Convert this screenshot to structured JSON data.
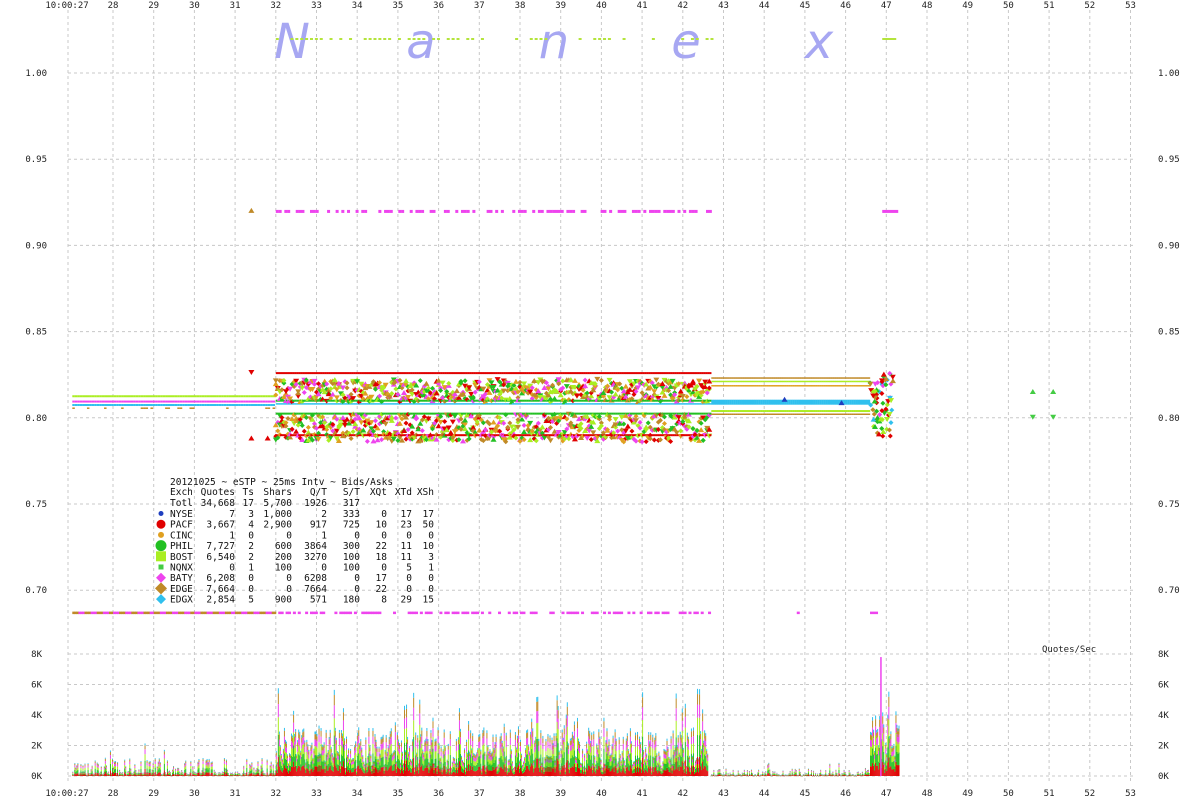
{
  "watermark": [
    "N",
    "a",
    "n",
    "e",
    "x"
  ],
  "chart_data": [
    {
      "type": "scatter",
      "subtype": "tick-chart",
      "title": "20121025 ~ eSTP ~ 25ms Intv ~ Bids/Asks",
      "x_start_label": "10:00:27",
      "x_labels": [
        "28",
        "29",
        "30",
        "31",
        "32",
        "33",
        "34",
        "35",
        "36",
        "37",
        "38",
        "39",
        "40",
        "41",
        "42",
        "43",
        "44",
        "45",
        "46",
        "47",
        "48",
        "49",
        "50",
        "51",
        "52",
        "53"
      ],
      "y_ticks": [
        "1.00",
        "0.95",
        "0.90",
        "0.85",
        "0.80",
        "0.75",
        "0.70"
      ],
      "ylim": [
        0.675,
        1.04
      ],
      "grid": true,
      "colors": {
        "NYSE": "#1f3fbf",
        "PACF": "#e00000",
        "CINC": "#e0a020",
        "PHIL": "#22c022",
        "BOST": "#aaee22",
        "NQNX": "#44cc44",
        "BATY": "#ee44ee",
        "EDGE": "#c08a28",
        "EDGX": "#30c0ee"
      },
      "series": [
        {
          "name": "EDGX",
          "segments": [
            {
              "x0": 27.0,
              "x1": 31.9,
              "bid": 0.808,
              "ask": 0.808
            },
            {
              "x0": 42.7,
              "x1": 46.5,
              "bid": 0.806,
              "ask": 0.81
            }
          ]
        },
        {
          "name": "BOST",
          "segments": [
            {
              "x0": 27.0,
              "x1": 31.9,
              "bid": 0.811,
              "ask": 0.811
            },
            {
              "x0": 42.7,
              "x1": 46.5,
              "bid": 0.819,
              "ask": 0.823
            }
          ]
        },
        {
          "name": "PACF",
          "segments": [
            {
              "x0": 32.0,
              "x1": 42.6,
              "bid": 0.789,
              "ask": 0.827
            }
          ]
        },
        {
          "name": "BATY",
          "segments": [
            {
              "x0": 31.9,
              "x1": 42.7,
              "bid": 0.687,
              "ask": 0.92
            }
          ]
        }
      ],
      "legend": {
        "headers": [
          "Exch",
          "Quotes",
          "Ts",
          "Shars",
          "Q/T",
          "S/T",
          "XQt",
          "XTd",
          "XSh"
        ],
        "total": [
          "Totl",
          "34,668",
          "17",
          "5,700",
          "1926",
          "317",
          "",
          "",
          ""
        ],
        "rows": [
          [
            "NYSE",
            "7",
            "3",
            "1,000",
            "2",
            "333",
            "0",
            "17",
            "17"
          ],
          [
            "PACF",
            "3,667",
            "4",
            "2,900",
            "917",
            "725",
            "10",
            "23",
            "50"
          ],
          [
            "CINC",
            "1",
            "0",
            "0",
            "1",
            "0",
            "0",
            "0",
            "0"
          ],
          [
            "PHIL",
            "7,727",
            "2",
            "600",
            "3864",
            "300",
            "22",
            "11",
            "10"
          ],
          [
            "BOST",
            "6,540",
            "2",
            "200",
            "3270",
            "100",
            "18",
            "11",
            "3"
          ],
          [
            "NQNX",
            "0",
            "1",
            "100",
            "0",
            "100",
            "0",
            "5",
            "1"
          ],
          [
            "BATY",
            "6,208",
            "0",
            "0",
            "6208",
            "0",
            "17",
            "0",
            "0"
          ],
          [
            "EDGE",
            "7,664",
            "0",
            "0",
            "7664",
            "0",
            "22",
            "0",
            "0"
          ],
          [
            "EDGX",
            "2,854",
            "5",
            "900",
            "571",
            "180",
            "8",
            "29",
            "15"
          ]
        ]
      }
    },
    {
      "type": "bar",
      "title": "Quotes/Sec",
      "y_ticks": [
        "8K",
        "6K",
        "4K",
        "2K",
        "0K"
      ],
      "ylim": [
        0,
        8000
      ],
      "grid": true,
      "bursts": [
        {
          "x0": 27.0,
          "x1": 32.0,
          "level": 1200
        },
        {
          "x0": 32.0,
          "x1": 42.6,
          "level": 3200
        },
        {
          "x0": 42.7,
          "x1": 46.6,
          "level": 500
        },
        {
          "x0": 46.6,
          "x1": 47.3,
          "level": 4500
        }
      ],
      "peak": 7800
    }
  ]
}
